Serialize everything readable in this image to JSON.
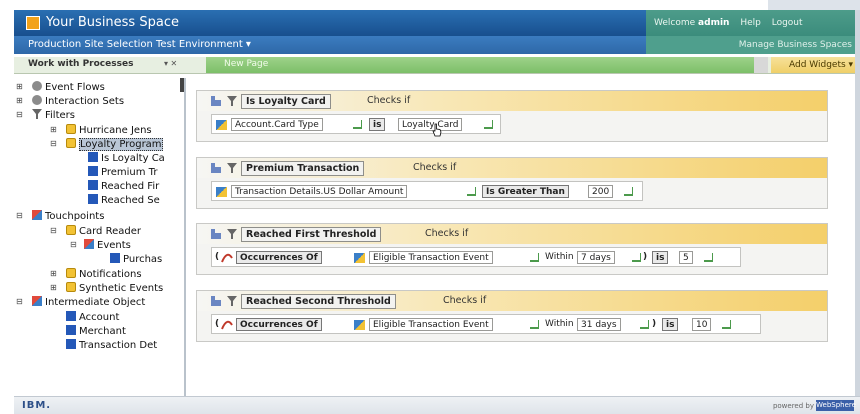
{
  "header": {
    "title": "Your Business Space",
    "welcome": "Welcome",
    "user": "admin",
    "help": "Help",
    "logout": "Logout",
    "environment": "Production Site Selection Test Environment ▾",
    "manage": "Manage Business Spaces"
  },
  "toolbar": {
    "work_with_processes": "Work with Processes",
    "controls": "▾ ✕",
    "new_page": "New Page",
    "add_widgets": "Add Widgets ▾"
  },
  "tree": {
    "event_flows": "Event Flows",
    "interaction_sets": "Interaction Sets",
    "filters": "Filters",
    "hurricane": "Hurricane Jens",
    "loyalty_program": "Loyalty Program",
    "is_loyalty": "Is Loyalty Ca",
    "premium": "Premium Tr",
    "reached_first": "Reached Fir",
    "reached_second": "Reached Se",
    "touchpoints": "Touchpoints",
    "card_reader": "Card Reader",
    "events": "Events",
    "purchase": "Purchas",
    "notifications": "Notifications",
    "synthetic_events": "Synthetic Events",
    "intermediate_objects": "Intermediate Object",
    "account": "Account",
    "merchant": "Merchant",
    "transaction_det": "Transaction Det"
  },
  "filters": [
    {
      "name": "Is Loyalty Card",
      "checks": "Checks if",
      "attribute": "Account.Card Type",
      "operator": "is",
      "value": "Loyalty Card"
    },
    {
      "name": "Premium Transaction",
      "checks": "Checks if",
      "attribute": "Transaction Details.US Dollar Amount",
      "operator": "Is Greater Than",
      "value": "200"
    },
    {
      "name": "Reached First Threshold",
      "checks": "Checks if",
      "paren": "(",
      "occurrences": "Occurrences Of",
      "event": "Eligible Transaction Event",
      "within": "Within",
      "period": "7 days",
      "close": ")",
      "operator": "is",
      "value": "5"
    },
    {
      "name": "Reached Second Threshold",
      "checks": "Checks if",
      "paren": "(",
      "occurrences": "Occurrences Of",
      "event": "Eligible Transaction Event",
      "within": "Within",
      "period": "31 days",
      "close": ")",
      "operator": "is",
      "value": "10"
    }
  ],
  "footer": {
    "ibm": "IBM.",
    "powered_by": "powered by",
    "websphere": "WebSphere"
  }
}
